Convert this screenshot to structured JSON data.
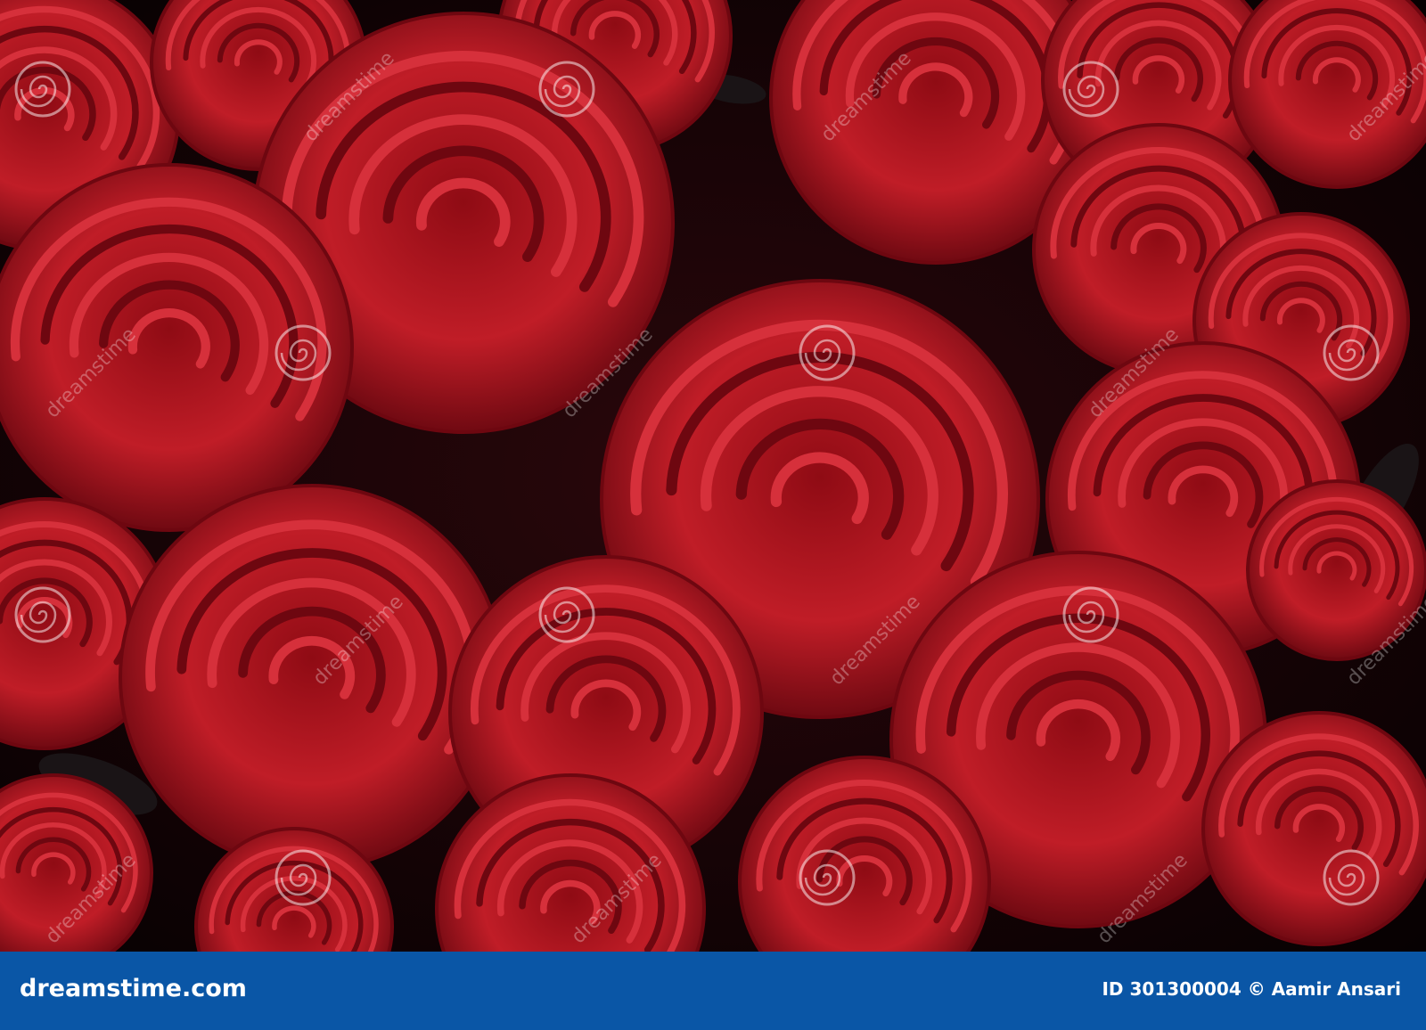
{
  "photo": {
    "subject": "red roses",
    "colors": {
      "petal": "#b3121d",
      "petal_dark": "#6e0710",
      "petal_light": "#d6303b",
      "background": "#120406",
      "leaf": "#1a1416"
    }
  },
  "watermark": {
    "text": "dreamstime",
    "logo_icon": "dreamstime-spiral-icon"
  },
  "footer": {
    "brand": "dreamstime.com",
    "credit": "ID 301300004 © Aamir Ansari",
    "background": "#0a56a6"
  }
}
